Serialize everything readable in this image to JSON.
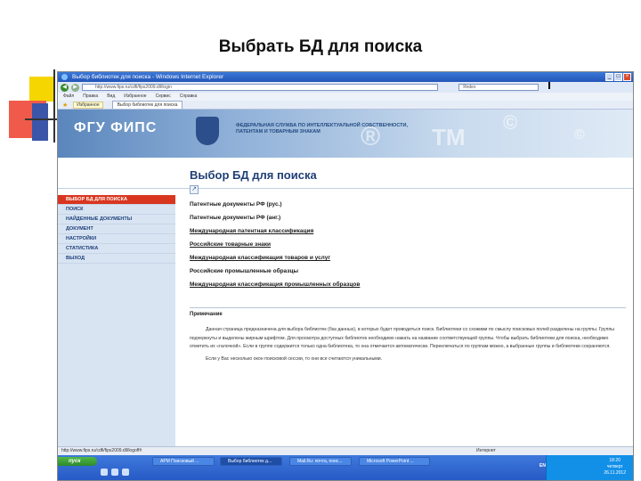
{
  "slide": {
    "title": "Выбрать БД для поиска"
  },
  "browser": {
    "title": "Выбор библиотек для поиска - Windows Internet Explorer",
    "address": "http://www.fips.ru/cdfi/fips2009.dll/login",
    "search_placeholder": "Яndex",
    "menu": [
      "Файл",
      "Правка",
      "Вид",
      "Избранное",
      "Сервис",
      "Справка"
    ],
    "favorites_label": "Избранное",
    "tab_label": "Выбор библиотек для поиска"
  },
  "banner": {
    "logo": "ФГУ ФИПС",
    "line1": "ФЕДЕРАЛЬНАЯ СЛУЖБА ПО ИНТЕЛЛЕКТУАЛЬНОЙ СОБСТВЕННОСТИ,",
    "line2": "ПАТЕНТАМ И ТОВАРНЫМ ЗНАКАМ"
  },
  "sidebar": {
    "items": [
      {
        "label": "ВЫБОР БД ДЛЯ ПОИСКА"
      },
      {
        "label": "ПОИСК"
      },
      {
        "label": "НАЙДЕННЫЕ ДОКУМЕНТЫ"
      },
      {
        "label": "ДОКУМЕНТ"
      },
      {
        "label": "НАСТРОЙКИ"
      },
      {
        "label": "СТАТИСТИКА"
      },
      {
        "label": "ВЫХОД"
      }
    ]
  },
  "main": {
    "title": "Выбор БД для поиска",
    "databases": [
      "Патентные документы РФ (рус.)",
      "Патентные документы РФ (анг.)",
      "Международная патентная классификация",
      "Российские товарные знаки",
      "Международная классификация товаров и услуг",
      "Российские промышленные образцы",
      "Международная классификация промышленных образцов"
    ],
    "note_heading": "Примечание",
    "note_text": "Данная страница предназначена для выбора библиотек (баз данных), в которых будет проводиться поиск. Библиотеки со схожими по смыслу поисковых полей разделены на группы. Группы подчеркнуты и выделены жирным шрифтом. Для просмотра доступных библиотек необходимо нажать на название соответствующей группы. Чтобы выбрать библиотеки для поиска, необходимо отметить их «галочкой». Если в группе содержится только одна библиотека, то она отмечается автоматически. Переключаться по группам можно, а выбранные группы и библиотеки сохраняются.",
    "note_text2": "Если у Вас несколько окон поисковой сессии, то они все считаются уникальными."
  },
  "statusbar": {
    "url": "http://www.fips.ru/cdfi/fips2009.dll/logoff#",
    "zone": "Интернет"
  },
  "taskbar": {
    "start": "пуск",
    "buttons": [
      "АРМ Поисковый ...",
      "Выбор библиотек д...",
      "Mail.Ru: почта, поис...",
      "Microsoft PowerPoint ..."
    ],
    "lang": "EN",
    "time": "18:20",
    "day": "четверг",
    "date": "26.11.2012"
  },
  "colors": {
    "accent": "#d9361f",
    "brand": "#1f3f76",
    "taskbar": "#2558c4"
  }
}
